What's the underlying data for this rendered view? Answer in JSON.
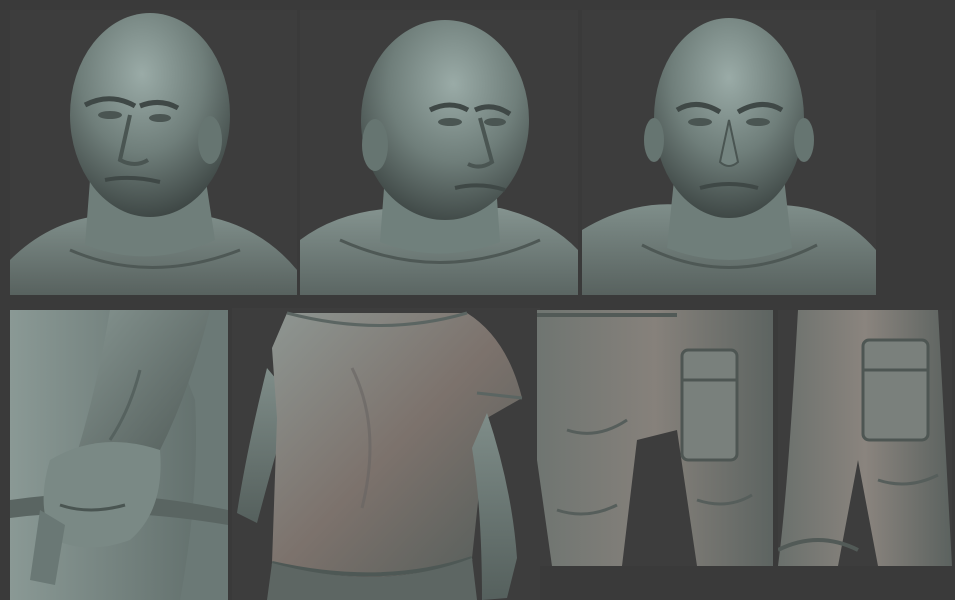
{
  "sheet": {
    "panels": [
      {
        "id": "head-left",
        "icon": "sculpt-head-three-quarter-left"
      },
      {
        "id": "head-right",
        "icon": "sculpt-head-three-quarter-right"
      },
      {
        "id": "head-front",
        "icon": "sculpt-head-front"
      },
      {
        "id": "arm-detail",
        "icon": "sculpt-arm-hand-closeup"
      },
      {
        "id": "torso",
        "icon": "sculpt-torso-tshirt"
      },
      {
        "id": "pants-front",
        "icon": "sculpt-cargo-pants-front"
      },
      {
        "id": "pants-side",
        "icon": "sculpt-cargo-pants-side"
      }
    ]
  },
  "colors": {
    "background": "#3a3a3a",
    "clay_light": "#8fa09c",
    "clay_mid": "#6d7c78",
    "clay_dark": "#3f4846",
    "clay_warm": "#7e6f68"
  }
}
